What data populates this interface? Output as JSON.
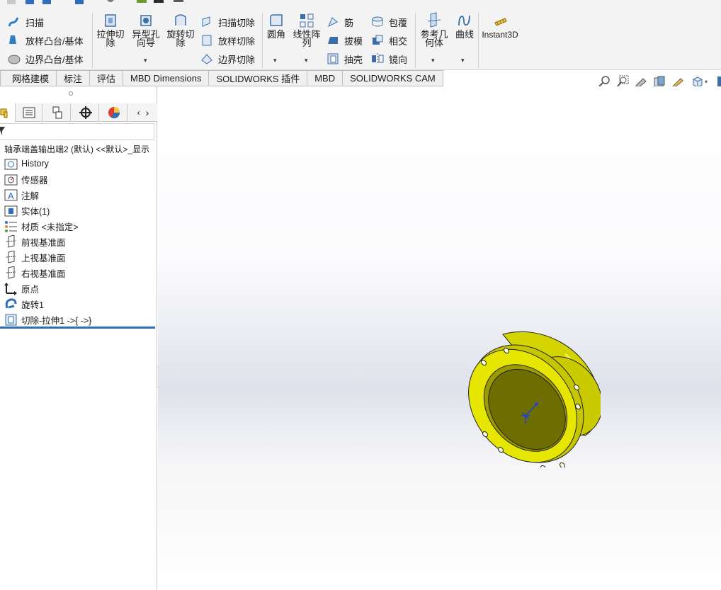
{
  "ribbon": {
    "sweep": "扫描",
    "loft_boss": "放样凸台/基体",
    "boundary_boss": "边界凸台/基体",
    "extrude_cut": "拉伸切\n除",
    "hole_wizard": "异型孔\n向导",
    "revolve_cut": "旋转切\n除",
    "swept_cut": "扫描切除",
    "lofted_cut": "放样切除",
    "boundary_cut": "边界切除",
    "fillet": "圆角",
    "linear_pattern": "线性阵\n列",
    "rib": "筋",
    "draft": "拔模",
    "shell": "抽壳",
    "wrap": "包覆",
    "intersect": "相交",
    "mirror": "镜向",
    "ref_geometry": "参考几\n何体",
    "curves": "曲线",
    "instant3d": "Instant3D"
  },
  "tabs": [
    "网格建模",
    "标注",
    "评估",
    "MBD Dimensions",
    "SOLIDWORKS 插件",
    "MBD",
    "SOLIDWORKS CAM"
  ],
  "tree": {
    "root": "轴承端盖输出端2 (默认) <<默认>_显示",
    "items": [
      {
        "label": "History",
        "icon": "history-folder-icon"
      },
      {
        "label": "传感器",
        "icon": "sensor-icon"
      },
      {
        "label": "注解",
        "icon": "annotation-icon"
      },
      {
        "label": "实体(1)",
        "icon": "solid-bodies-icon"
      },
      {
        "label": "材质 <未指定>",
        "icon": "material-icon"
      },
      {
        "label": "前视基准面",
        "icon": "plane-icon"
      },
      {
        "label": "上视基准面",
        "icon": "plane-icon"
      },
      {
        "label": "右视基准面",
        "icon": "plane-icon"
      },
      {
        "label": "原点",
        "icon": "origin-icon"
      },
      {
        "label": "旋转1",
        "icon": "revolve-icon"
      },
      {
        "label": "切除-拉伸1 ->{ ->}",
        "icon": "cut-extrude-icon"
      }
    ]
  },
  "colors": {
    "part_yellow": "#e6e600",
    "part_dark": "#6e6d00",
    "rollback_bar": "#2f6fb7",
    "triad_blue": "#1f3fd6"
  }
}
